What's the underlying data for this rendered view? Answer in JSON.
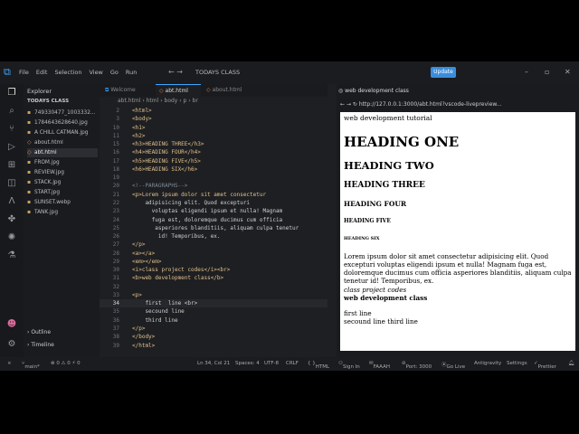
{
  "titlebar": {
    "menu": [
      "File",
      "Edit",
      "Selection",
      "View",
      "Go",
      "Run"
    ],
    "nav_glyphs": "←  →",
    "command_center": "TODAYS CLASS",
    "update_label": "Update"
  },
  "sidebar": {
    "header": "Explorer",
    "section": "TODAYS CLASS",
    "files": [
      "749330477_1003332...",
      "1784643628640.jpg",
      "A CHILL CATMAN.jpg",
      "about.html",
      "abt.html",
      "FROM.jpg",
      "REVIEW.jpg",
      "STACK.jpg",
      "START.jpg",
      "SUNSET.webp",
      "TANK.jpg"
    ],
    "outline_label": "Outline",
    "timeline_label": "Timeline"
  },
  "editor": {
    "tabs": [
      "Welcome",
      "abt.html",
      "about.html"
    ],
    "breadcrumb": "abt.html  ›  html  ›  body  ›  p  ›  br",
    "lines": [
      {
        "no": "2",
        "text": "<html>"
      },
      {
        "no": "3",
        "text": "<body>"
      },
      {
        "no": "10",
        "text": "<h1>"
      },
      {
        "no": "11",
        "text": "<h2>"
      },
      {
        "no": "15",
        "text": "<h3>HEADING THREE</h3>"
      },
      {
        "no": "16",
        "text": "<h4>HEADING FOUR</h4>"
      },
      {
        "no": "17",
        "text": "<h5>HEADING FIVE</h5>"
      },
      {
        "no": "18",
        "text": "<h6>HEADING SIX</h6>"
      },
      {
        "no": "19",
        "text": ""
      },
      {
        "no": "20",
        "text": "<!--PARAGRAPHS-->"
      },
      {
        "no": "21",
        "text": "<p>Lorem ipsum dolor sit amet consectetur"
      },
      {
        "no": "22",
        "text": "    adipisicing elit. Quod excepturi"
      },
      {
        "no": "23",
        "text": "      voluptas eligendi ipsum et nulla! Magnam"
      },
      {
        "no": "24",
        "text": "      fuga est, doloremque ducimus cum officia"
      },
      {
        "no": "25",
        "text": "       asperiores blanditiis, aliquam culpa tenetur"
      },
      {
        "no": "26",
        "text": "        id! Temporibus, ex."
      },
      {
        "no": "27",
        "text": "</p>"
      },
      {
        "no": "28",
        "text": "<a></a>"
      },
      {
        "no": "29",
        "text": "<em></em>"
      },
      {
        "no": "30",
        "text": "<i>class project codes</i><br>"
      },
      {
        "no": "31",
        "text": "<b>web development class</b>"
      },
      {
        "no": "32",
        "text": ""
      },
      {
        "no": "33",
        "text": "<p>"
      },
      {
        "no": "34",
        "text": "    first  line <br>"
      },
      {
        "no": "35",
        "text": "    secound line"
      },
      {
        "no": "36",
        "text": "    third line"
      },
      {
        "no": "37",
        "text": "</p>"
      },
      {
        "no": "38",
        "text": "</body>"
      },
      {
        "no": "39",
        "text": "</html>"
      }
    ],
    "current_line": "34"
  },
  "preview": {
    "tab_title": "web development class",
    "url": "http://127.0.0.1:3000/abt.html?vscode-livepreview...",
    "title_text": "web development tutorial",
    "h1": "HEADING ONE",
    "h2": "HEADING TWO",
    "h3": "HEADING THREE",
    "h4": "HEADING FOUR",
    "h5": "HEADING FIVE",
    "h6": "HEADING SIX",
    "paragraph": "Lorem ipsum dolor sit amet consectetur adipisicing elit. Quod excepturi voluptas eligendi ipsum et nulla! Magnam fuga est, doloremque ducimus cum officia asperiores blanditiis, aliquam culpa tenetur id! Temporibus, ex.",
    "italic": "class project codes",
    "bold": "web development class",
    "line1": "first line",
    "line2": "secound line third line"
  },
  "status": {
    "branch": "main*",
    "problems": "⊗ 0  ⚠ 0    ⚡ 0",
    "cursor": "Ln 34, Col 21",
    "spaces": "Spaces: 4",
    "encoding": "UTF-8",
    "eol": "CRLF",
    "language": "HTML",
    "signin": "Sign In",
    "user": "FAAAH",
    "port": "Port: 3000",
    "golive": "Go Live",
    "antigravity": "Antigravity",
    "settings": "Settings",
    "prettier": "Prettier"
  }
}
